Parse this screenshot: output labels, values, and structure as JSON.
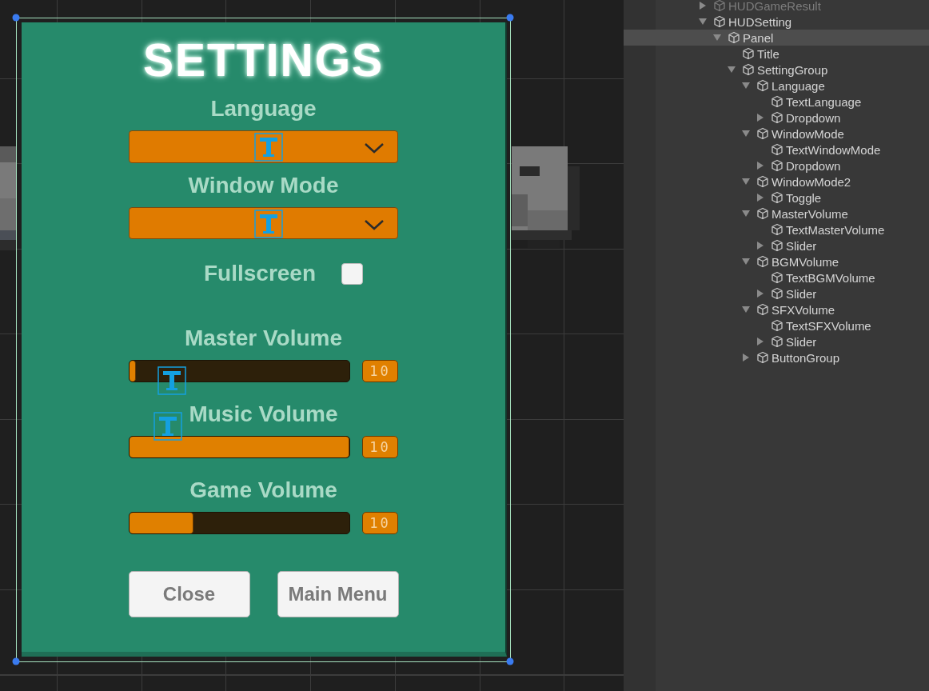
{
  "panel": {
    "title": "SETTINGS",
    "dropdowns": [
      {
        "label": "Language"
      },
      {
        "label": "Window Mode"
      }
    ],
    "toggle": {
      "label": "Fullscreen",
      "checked": false
    },
    "sliders": [
      {
        "label": "Master Volume",
        "level": 0.03,
        "value_text": "10"
      },
      {
        "label": "Music Volume",
        "level": 1.0,
        "value_text": "10"
      },
      {
        "label": "Game Volume",
        "level": 0.29,
        "value_text": "10"
      }
    ],
    "buttons": [
      "Close",
      "Main Menu"
    ]
  },
  "hierarchy": {
    "items": [
      {
        "name": "HUDGameResult",
        "selected": false,
        "disabled": true,
        "expanded": false
      },
      {
        "name": "HUDSetting",
        "selected": false,
        "disabled": false,
        "expanded": true,
        "children": [
          {
            "name": "Panel",
            "selected": true,
            "disabled": false,
            "expanded": true,
            "children": [
              {
                "name": "Title",
                "selected": false,
                "disabled": false
              },
              {
                "name": "SettingGroup",
                "selected": false,
                "disabled": false,
                "expanded": true,
                "children": [
                  {
                    "name": "Language",
                    "selected": false,
                    "disabled": false,
                    "expanded": true,
                    "children": [
                      {
                        "name": "TextLanguage",
                        "selected": false,
                        "disabled": false
                      },
                      {
                        "name": "Dropdown",
                        "selected": false,
                        "disabled": false,
                        "expanded": false
                      }
                    ]
                  },
                  {
                    "name": "WindowMode",
                    "selected": false,
                    "disabled": false,
                    "expanded": true,
                    "children": [
                      {
                        "name": "TextWindowMode",
                        "selected": false,
                        "disabled": false
                      },
                      {
                        "name": "Dropdown",
                        "selected": false,
                        "disabled": false,
                        "expanded": false
                      }
                    ]
                  },
                  {
                    "name": "WindowMode2",
                    "selected": false,
                    "disabled": false,
                    "expanded": true,
                    "children": [
                      {
                        "name": "Toggle",
                        "selected": false,
                        "disabled": false,
                        "expanded": false
                      }
                    ]
                  },
                  {
                    "name": "MasterVolume",
                    "selected": false,
                    "disabled": false,
                    "expanded": true,
                    "children": [
                      {
                        "name": "TextMasterVolume",
                        "selected": false,
                        "disabled": false
                      },
                      {
                        "name": "Slider",
                        "selected": false,
                        "disabled": false,
                        "expanded": false
                      }
                    ]
                  },
                  {
                    "name": "BGMVolume",
                    "selected": false,
                    "disabled": false,
                    "expanded": true,
                    "children": [
                      {
                        "name": "TextBGMVolume",
                        "selected": false,
                        "disabled": false
                      },
                      {
                        "name": "Slider",
                        "selected": false,
                        "disabled": false,
                        "expanded": false
                      }
                    ]
                  },
                  {
                    "name": "SFXVolume",
                    "selected": false,
                    "disabled": false,
                    "expanded": true,
                    "children": [
                      {
                        "name": "TextSFXVolume",
                        "selected": false,
                        "disabled": false
                      },
                      {
                        "name": "Slider",
                        "selected": false,
                        "disabled": false,
                        "expanded": false
                      }
                    ]
                  },
                  {
                    "name": "ButtonGroup",
                    "selected": false,
                    "disabled": false,
                    "expanded": false
                  }
                ]
              }
            ]
          }
        ]
      }
    ]
  }
}
